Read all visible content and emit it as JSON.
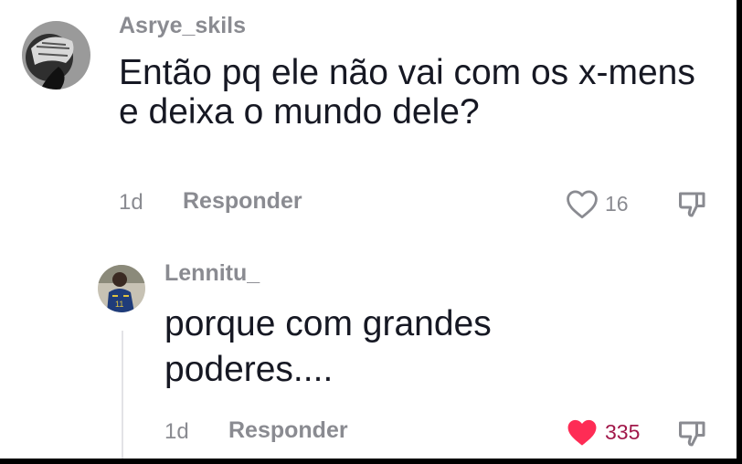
{
  "comments": [
    {
      "username": "Asrye_skils",
      "text": "Então pq ele não vai com os x-mens e deixa o mundo dele?",
      "time": "1d",
      "reply_label": "Responder",
      "likes": "16",
      "liked": false
    }
  ],
  "replies": [
    {
      "username": "Lennitu_",
      "text": "porque com grandes poderes....",
      "time": "1d",
      "reply_label": "Responder",
      "likes": "335",
      "liked": true
    }
  ],
  "colors": {
    "liked_heart": "#fe2c55",
    "liked_count": "#a1184a",
    "muted_text": "#8a8b91",
    "body_text": "#161823"
  },
  "icons": {
    "like": "heart-outline-icon",
    "liked": "heart-filled-icon",
    "dislike": "thumbs-down-icon"
  }
}
